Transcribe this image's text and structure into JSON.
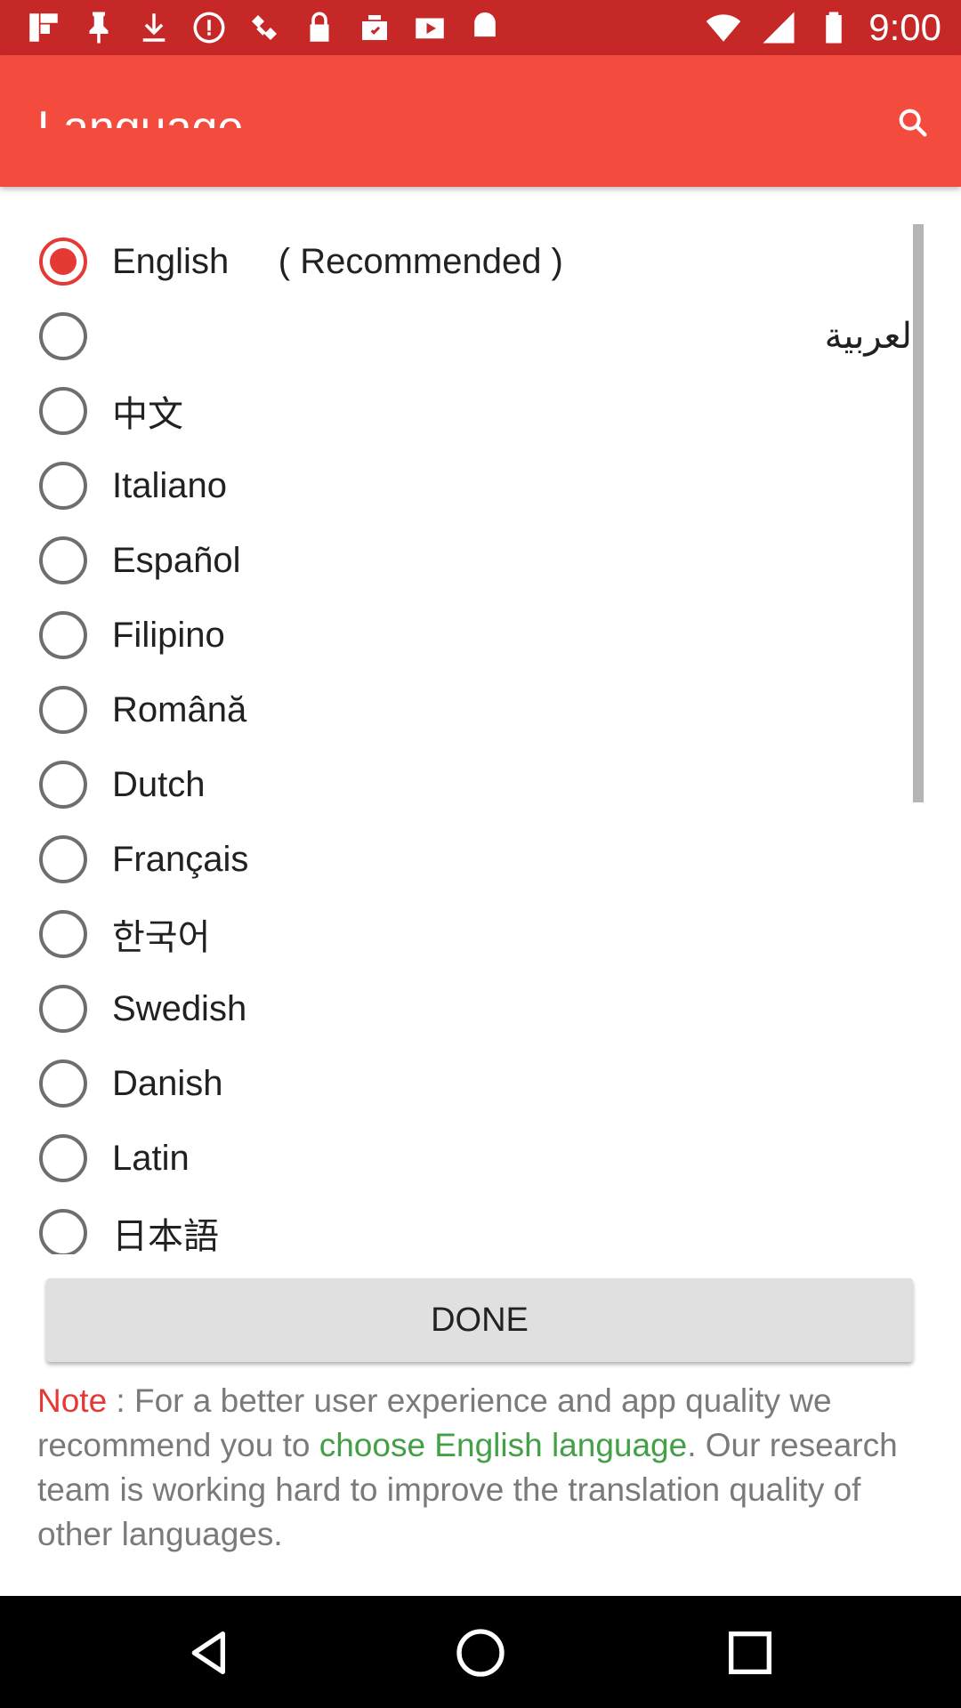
{
  "status_bar": {
    "time": "9:00",
    "icons": [
      "flipboard-icon",
      "pin-icon",
      "download-icon",
      "alert-icon",
      "satellite-icon",
      "lock-icon",
      "clipboard-check-icon",
      "video-icon",
      "android-icon"
    ]
  },
  "app_bar": {
    "title": "Language",
    "search_icon": "search-icon"
  },
  "languages": [
    {
      "label": "English     ( Recommended )",
      "selected": true
    },
    {
      "label": "العربية",
      "selected": false,
      "rtl": true
    },
    {
      "label": "中文",
      "selected": false
    },
    {
      "label": "Italiano",
      "selected": false
    },
    {
      "label": "Español",
      "selected": false
    },
    {
      "label": "Filipino",
      "selected": false
    },
    {
      "label": "Română",
      "selected": false
    },
    {
      "label": "Dutch",
      "selected": false
    },
    {
      "label": "Français",
      "selected": false
    },
    {
      "label": "한국어",
      "selected": false
    },
    {
      "label": "Swedish",
      "selected": false
    },
    {
      "label": "Danish",
      "selected": false
    },
    {
      "label": "Latin",
      "selected": false
    },
    {
      "label": "日本語",
      "selected": false
    }
  ],
  "done_button": {
    "label": "DONE"
  },
  "note": {
    "label": "Note",
    "text_1": " : For a better user experience and app quality we recommend you to ",
    "link": "choose English language",
    "text_2": ". Our research team is working hard to improve the translation quality of other languages."
  },
  "colors": {
    "status_bar": "#c62828",
    "app_bar": "#f44b3f",
    "accent": "#e53935",
    "link": "#43a047"
  },
  "nav_bar": {
    "icons": [
      "back-icon",
      "home-icon",
      "recents-icon"
    ]
  }
}
